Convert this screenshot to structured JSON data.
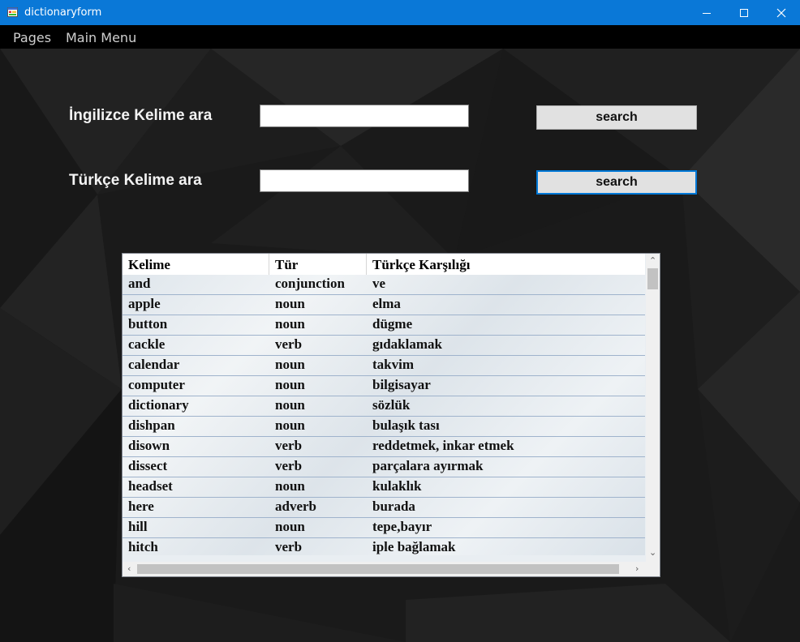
{
  "window": {
    "title": "dictionaryform",
    "icon": "app-form-icon",
    "controls": [
      "minimize-icon",
      "maximize-icon",
      "close-icon"
    ]
  },
  "menu": {
    "items": [
      {
        "label": "Pages"
      },
      {
        "label": "Main Menu"
      }
    ]
  },
  "search": {
    "english_label": "İngilizce Kelime ara",
    "english_value": "",
    "english_button": "search",
    "turkish_label": "Türkçe Kelime ara",
    "turkish_value": "",
    "turkish_button": "search"
  },
  "table": {
    "columns": [
      "Kelime",
      "Tür",
      "Türkçe Karşılığı"
    ],
    "rows": [
      [
        "and",
        "conjunction",
        "ve"
      ],
      [
        "apple",
        "noun",
        "elma"
      ],
      [
        "button",
        "noun",
        "dügme"
      ],
      [
        "cackle",
        "verb",
        "gıdaklamak"
      ],
      [
        "calendar",
        "noun",
        "takvim"
      ],
      [
        "computer",
        "noun",
        "bilgisayar"
      ],
      [
        "dictionary",
        "noun",
        "sözlük"
      ],
      [
        "dishpan",
        "noun",
        "bulaşık tası"
      ],
      [
        "disown",
        "verb",
        "reddetmek, inkar etmek"
      ],
      [
        "dissect",
        "verb",
        "parçalara ayırmak"
      ],
      [
        "headset",
        "noun",
        "kulaklık"
      ],
      [
        "here",
        "adverb",
        "burada"
      ],
      [
        "hill",
        "noun",
        "tepe,bayır"
      ],
      [
        "hitch",
        "verb",
        "iple bağlamak"
      ]
    ]
  },
  "colors": {
    "titlebar": "#0a78d7",
    "menubar": "#000000",
    "background": "#1b1b1b",
    "focus_border": "#0078d7"
  }
}
